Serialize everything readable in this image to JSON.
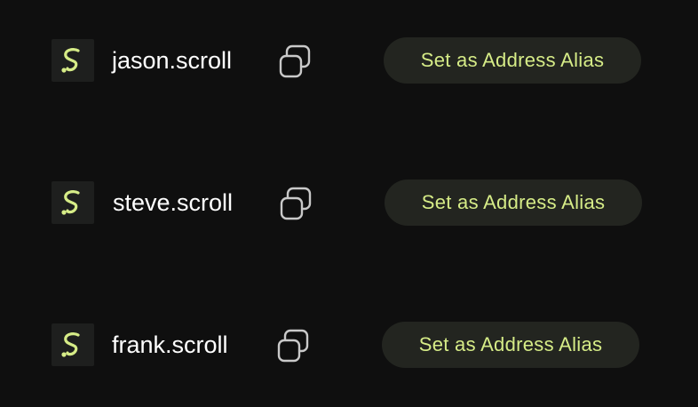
{
  "theme": {
    "background": "#0f0f0f",
    "accent": "#d6ec87",
    "button_background": "#232520",
    "logo_background": "#1e1f1e"
  },
  "rows": [
    {
      "name": "jason.scroll",
      "logo_icon": "scroll-logo-icon",
      "copy_icon": "copy-icon",
      "button_label": "Set as Address Alias"
    },
    {
      "name": "steve.scroll",
      "logo_icon": "scroll-logo-icon",
      "copy_icon": "copy-icon",
      "button_label": "Set as Address Alias"
    },
    {
      "name": "frank.scroll",
      "logo_icon": "scroll-logo-icon",
      "copy_icon": "copy-icon",
      "button_label": "Set as Address Alias"
    }
  ]
}
